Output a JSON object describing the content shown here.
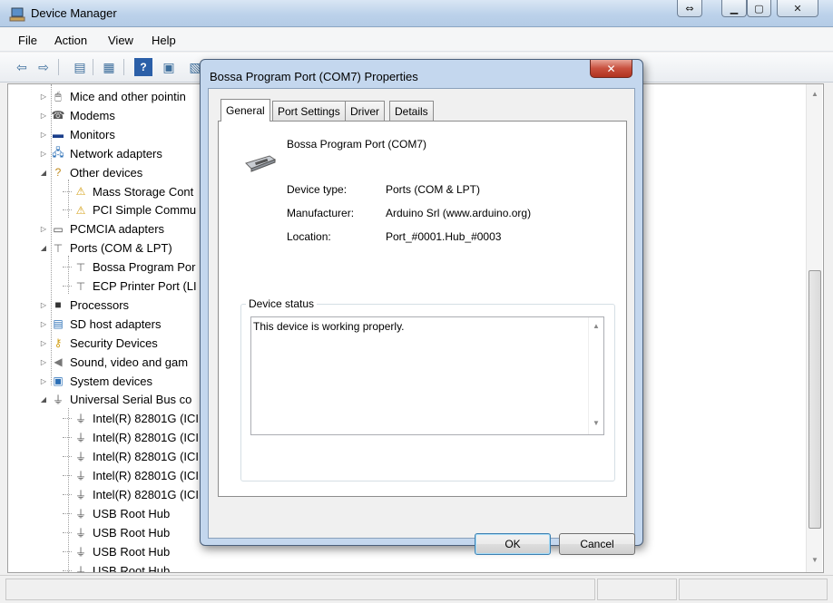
{
  "window": {
    "title": "Device Manager",
    "caption_alt": "⇔",
    "minimize": "▁",
    "maximize": "▢",
    "close": "✕"
  },
  "menu": [
    "File",
    "Action",
    "View",
    "Help"
  ],
  "tree": {
    "items": [
      {
        "label": "Mice and other pointin",
        "expander": "▷",
        "icon": "mouse-icon"
      },
      {
        "label": "Modems",
        "expander": "▷",
        "icon": "modem-icon"
      },
      {
        "label": "Monitors",
        "expander": "▷",
        "icon": "monitor-icon"
      },
      {
        "label": "Network adapters",
        "expander": "▷",
        "icon": "network-icon"
      },
      {
        "label": "Other devices",
        "expander": "◢",
        "icon": "unknown-device-icon"
      },
      {
        "label": "Mass Storage Cont",
        "expander": "",
        "icon": "warning-device-icon"
      },
      {
        "label": "PCI Simple Commu",
        "expander": "",
        "icon": "warning-device-icon"
      },
      {
        "label": "PCMCIA adapters",
        "expander": "▷",
        "icon": "pcmcia-icon"
      },
      {
        "label": "Ports (COM & LPT)",
        "expander": "◢",
        "icon": "port-icon"
      },
      {
        "label": "Bossa Program Por",
        "expander": "",
        "icon": "port-icon"
      },
      {
        "label": "ECP Printer Port (LI",
        "expander": "",
        "icon": "port-icon"
      },
      {
        "label": "Processors",
        "expander": "▷",
        "icon": "processor-icon"
      },
      {
        "label": "SD host adapters",
        "expander": "▷",
        "icon": "sd-icon"
      },
      {
        "label": "Security Devices",
        "expander": "▷",
        "icon": "key-icon"
      },
      {
        "label": "Sound, video and gam",
        "expander": "▷",
        "icon": "speaker-icon"
      },
      {
        "label": "System devices",
        "expander": "▷",
        "icon": "computer-icon"
      },
      {
        "label": "Universal Serial Bus co",
        "expander": "◢",
        "icon": "usb-icon"
      },
      {
        "label": "Intel(R) 82801G (ICI",
        "expander": "",
        "icon": "usb-icon"
      },
      {
        "label": "Intel(R) 82801G (ICI",
        "expander": "",
        "icon": "usb-icon"
      },
      {
        "label": "Intel(R) 82801G (ICI",
        "expander": "",
        "icon": "usb-icon"
      },
      {
        "label": "Intel(R) 82801G (ICI",
        "expander": "",
        "icon": "usb-icon"
      },
      {
        "label": "Intel(R) 82801G (ICI",
        "expander": "",
        "icon": "usb-icon"
      },
      {
        "label": "USB Root Hub",
        "expander": "",
        "icon": "usb-icon"
      },
      {
        "label": "USB Root Hub",
        "expander": "",
        "icon": "usb-icon"
      },
      {
        "label": "USB Root Hub",
        "expander": "",
        "icon": "usb-icon"
      },
      {
        "label": "USB Root Hub",
        "expander": "",
        "icon": "usb-icon"
      }
    ]
  },
  "dialog": {
    "title": "Bossa Program Port (COM7) Properties",
    "close": "✕",
    "tabs": [
      "General",
      "Port Settings",
      "Driver",
      "Details"
    ],
    "active_tab": "General",
    "device_name": "Bossa Program Port (COM7)",
    "properties": [
      {
        "label": "Device type:",
        "value": "Ports (COM & LPT)"
      },
      {
        "label": "Manufacturer:",
        "value": "Arduino Srl (www.arduino.org)"
      },
      {
        "label": "Location:",
        "value": "Port_#0001.Hub_#0003"
      }
    ],
    "status_group_label": "Device status",
    "status_text": "This device is working properly.",
    "ok_label": "OK",
    "cancel_label": "Cancel"
  },
  "colors": {
    "accent": "#3c7fb1",
    "close_red": "#c8503e"
  }
}
